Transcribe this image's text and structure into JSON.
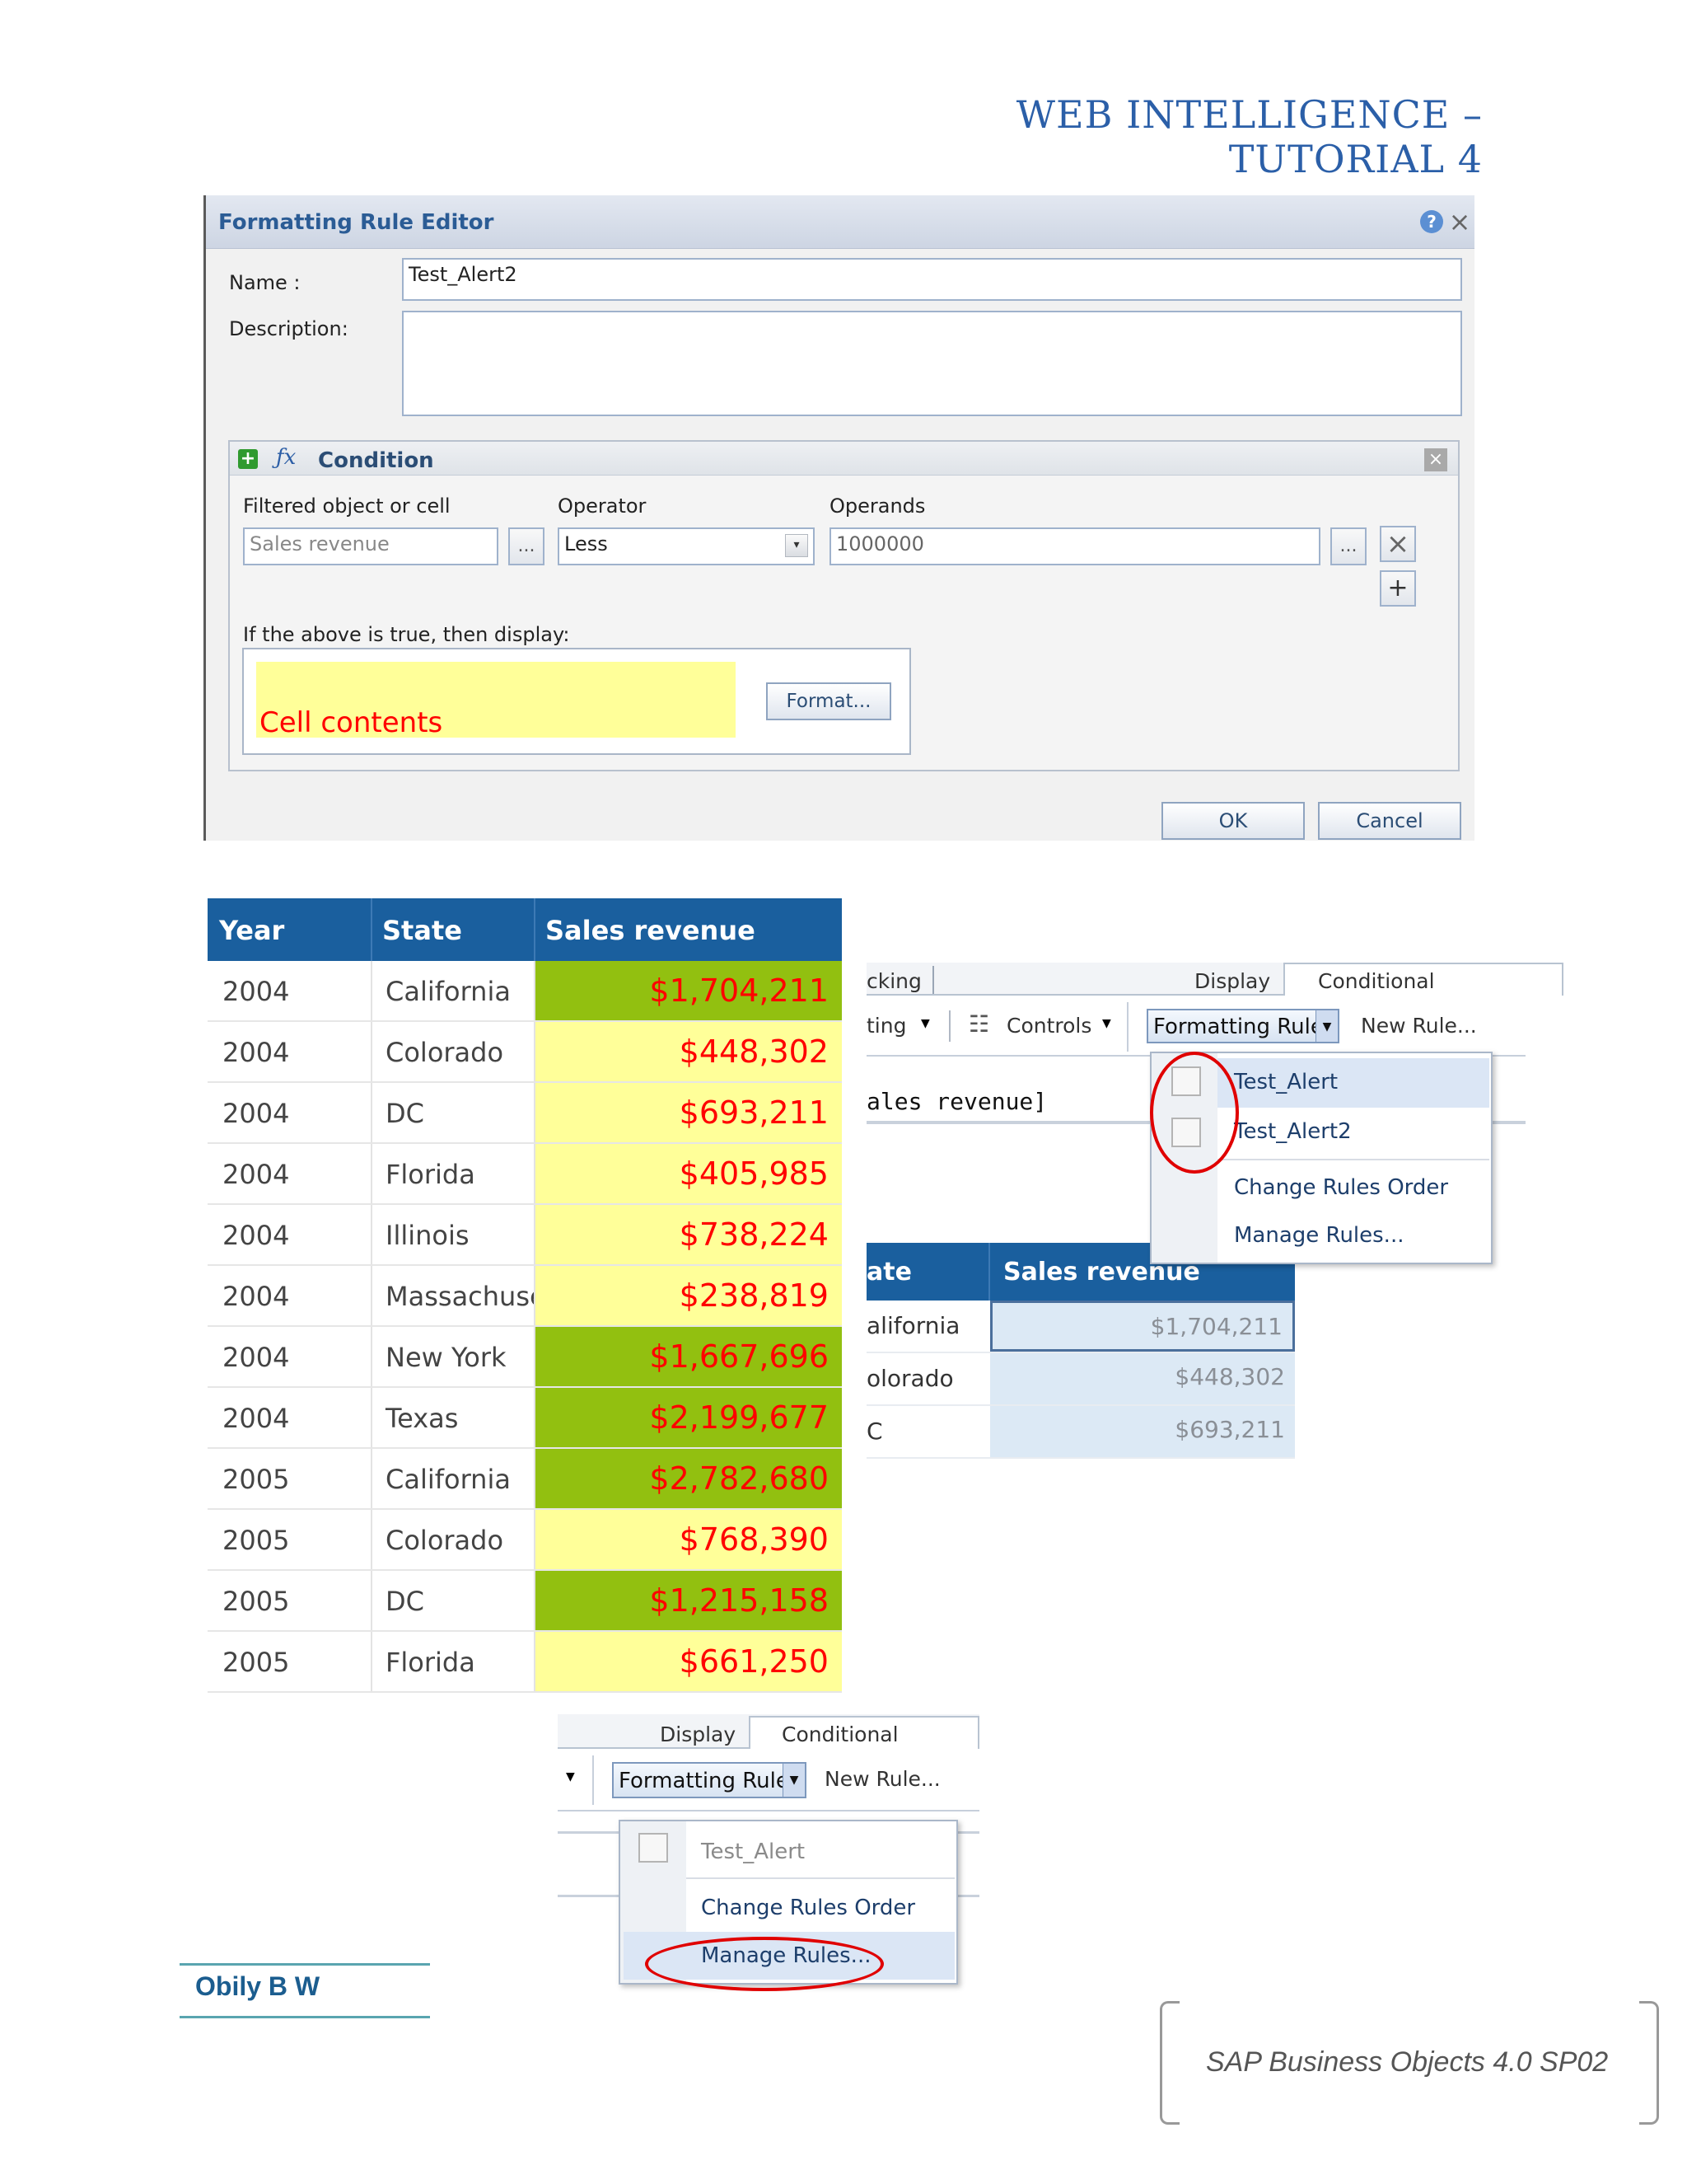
{
  "page": {
    "header": "WEB INTELLIGENCE – TUTORIAL 4"
  },
  "dialog": {
    "title": "Formatting Rule Editor",
    "name_label": "Name :",
    "name_value": "Test_Alert2",
    "description_label": "Description:",
    "description_value": "",
    "condition": {
      "title": "Condition",
      "col_filtered": "Filtered object or cell",
      "col_operator": "Operator",
      "col_operands": "Operands",
      "filtered_value": "Sales revenue",
      "operator_value": "Less",
      "operand_value": "1000000",
      "ellipsis": "...",
      "add_symbol": "+",
      "then_label": "If the above is true, then display:",
      "cell_contents": "Cell contents",
      "format_button": "Format..."
    },
    "ok_button": "OK",
    "cancel_button": "Cancel"
  },
  "table": {
    "headers": [
      "Year",
      "State",
      "Sales revenue"
    ],
    "colors": {
      "green": "#92c010",
      "yellow": "#ffff99"
    },
    "rows": [
      {
        "year": "2004",
        "state": "California",
        "revenue": "$1,704,211",
        "highlight": "green"
      },
      {
        "year": "2004",
        "state": "Colorado",
        "revenue": "$448,302",
        "highlight": "yellow"
      },
      {
        "year": "2004",
        "state": "DC",
        "revenue": "$693,211",
        "highlight": "yellow"
      },
      {
        "year": "2004",
        "state": "Florida",
        "revenue": "$405,985",
        "highlight": "yellow"
      },
      {
        "year": "2004",
        "state": "Illinois",
        "revenue": "$738,224",
        "highlight": "yellow"
      },
      {
        "year": "2004",
        "state": "Massachuset",
        "revenue": "$238,819",
        "highlight": "yellow"
      },
      {
        "year": "2004",
        "state": "New York",
        "revenue": "$1,667,696",
        "highlight": "green"
      },
      {
        "year": "2004",
        "state": "Texas",
        "revenue": "$2,199,677",
        "highlight": "green"
      },
      {
        "year": "2005",
        "state": "California",
        "revenue": "$2,782,680",
        "highlight": "green"
      },
      {
        "year": "2005",
        "state": "Colorado",
        "revenue": "$768,390",
        "highlight": "yellow"
      },
      {
        "year": "2005",
        "state": "DC",
        "revenue": "$1,215,158",
        "highlight": "green"
      },
      {
        "year": "2005",
        "state": "Florida",
        "revenue": "$661,250",
        "highlight": "yellow"
      }
    ]
  },
  "toolbar1": {
    "tab_partial": "cking",
    "tab_display": "Display",
    "tab_conditional": "Conditional",
    "item_partial": "ting",
    "controls_label": "Controls",
    "rules_button": "Formatting Rules",
    "new_rule": "New Rule...",
    "formula_text": "ales revenue]",
    "menu": [
      "Test_Alert",
      "Test_Alert2",
      "Change Rules Order",
      "Manage Rules..."
    ],
    "mini_table": {
      "headers": [
        "ate",
        "Sales revenue"
      ],
      "rows": [
        {
          "state": "alifornia",
          "revenue": "$1,704,211"
        },
        {
          "state": "olorado",
          "revenue": "$448,302"
        },
        {
          "state": "C",
          "revenue": "$693,211"
        }
      ]
    }
  },
  "toolbar2": {
    "tab_display": "Display",
    "tab_conditional": "Conditional",
    "rules_button": "Formatting Rules",
    "new_rule": "New Rule...",
    "menu": [
      "Test_Alert",
      "Change Rules Order",
      "Manage Rules..."
    ]
  },
  "footer": {
    "author": "Obily B W",
    "product": "SAP Business Objects 4.0 SP02"
  }
}
